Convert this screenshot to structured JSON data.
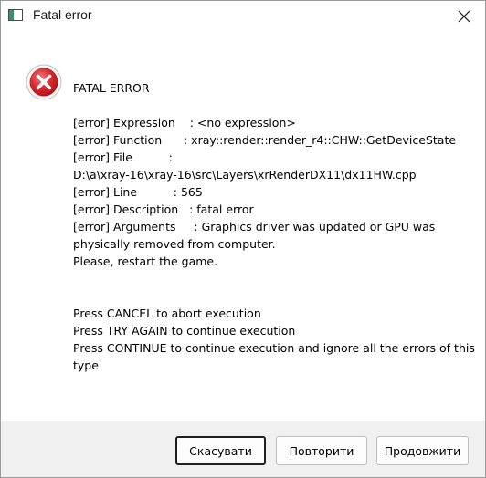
{
  "window": {
    "title": "Fatal error"
  },
  "icons": {
    "app": "application-window-icon",
    "close": "close-icon",
    "error": "error-x-icon",
    "error_color": "#d8262b"
  },
  "message": {
    "heading": "FATAL ERROR",
    "details": "[error] Expression    : <no expression>\n[error] Function      : xray::render::render_r4::CHW::GetDeviceState\n[error] File          :\nD:\\a\\xray-16\\xray-16\\src\\Layers\\xrRenderDX11\\dx11HW.cpp\n[error] Line          : 565\n[error] Description   : fatal error\n[error] Arguments     : Graphics driver was updated or GPU was physically removed from computer.\nPlease, restart the game.",
    "instructions": "Press CANCEL to abort execution\nPress TRY AGAIN to continue execution\nPress CONTINUE to continue execution and ignore all the errors of this type"
  },
  "buttons": {
    "cancel": "Скасувати",
    "retry": "Повторити",
    "continue": "Продовжити"
  }
}
